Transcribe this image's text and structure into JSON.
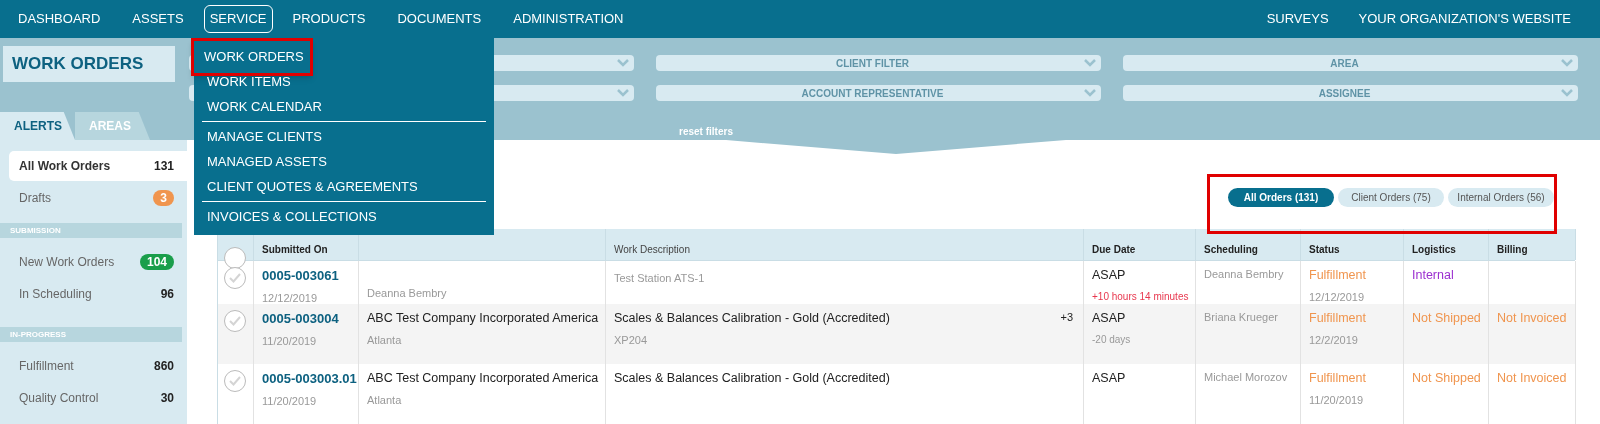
{
  "nav": {
    "items": [
      {
        "label": "DASHBOARD",
        "selected": false
      },
      {
        "label": "ASSETS",
        "selected": false
      },
      {
        "label": "SERVICE",
        "selected": true
      },
      {
        "label": "PRODUCTS",
        "selected": false
      },
      {
        "label": "DOCUMENTS",
        "selected": false
      },
      {
        "label": "ADMINISTRATION",
        "selected": false
      }
    ],
    "right_items": [
      "SURVEYS",
      "YOUR ORGANIZATION'S WEBSITE"
    ]
  },
  "service_menu": {
    "groups": [
      {
        "items": [
          {
            "label": "WORK ORDERS",
            "highlighted": true
          },
          {
            "label": "WORK ITEMS",
            "highlighted": false
          },
          {
            "label": "WORK CALENDAR",
            "highlighted": false
          }
        ]
      },
      {
        "items": [
          {
            "label": "MANAGE CLIENTS",
            "highlighted": false
          },
          {
            "label": "MANAGED ASSETS",
            "highlighted": false
          },
          {
            "label": "CLIENT QUOTES & AGREEMENTS",
            "highlighted": false
          }
        ]
      },
      {
        "items": [
          {
            "label": "INVOICES & COLLECTIONS",
            "highlighted": false
          }
        ]
      }
    ]
  },
  "page_title": "WORK ORDERS",
  "filters": {
    "rows": [
      [
        {},
        {
          "placeholder": "CLIENT FILTER"
        },
        {
          "placeholder": "AREA"
        }
      ],
      [
        {},
        {
          "placeholder": "ACCOUNT REPRESENTATIVE"
        },
        {
          "placeholder": "ASSIGNEE"
        }
      ]
    ],
    "reset": "reset filters"
  },
  "sidebar": {
    "tabs": [
      {
        "label": "ALERTS",
        "selected": true
      },
      {
        "label": "AREAS",
        "selected": false
      }
    ],
    "sections": [
      {
        "items": [
          {
            "label": "All Work Orders",
            "count": "131",
            "selected": true
          },
          {
            "label": "Drafts",
            "count": "3",
            "selected": false,
            "color": "#f0954e"
          }
        ]
      },
      {
        "title": "SUBMISSION",
        "items": [
          {
            "label": "New Work Orders",
            "count": "104",
            "selected": false,
            "color": "#1a9e4b"
          },
          {
            "label": "In Scheduling",
            "count": "96",
            "selected": false
          }
        ]
      },
      {
        "title": "IN-PROGRESS",
        "items": [
          {
            "label": "Fulfillment",
            "count": "860",
            "selected": false
          },
          {
            "label": "Quality Control",
            "count": "30",
            "selected": false
          }
        ]
      }
    ]
  },
  "order_filter": {
    "highlighted": true,
    "pills": [
      {
        "label": "All Orders (131)",
        "selected": true
      },
      {
        "label": "Client Orders (75)",
        "selected": false
      },
      {
        "label": "Internal Orders (56)",
        "selected": false
      }
    ]
  },
  "table": {
    "all_checked": false,
    "columns": [
      "Submitted On",
      "Work Description",
      "Due Date",
      "Scheduling",
      "Status",
      "Logistics",
      "Billing"
    ],
    "rows": [
      {
        "checked": false,
        "order": "0005-003061",
        "date": "12/12/2019",
        "client_sub": "Deanna Bembry",
        "description_sub": "Test Station ATS-1",
        "due": "ASAP",
        "due_note": {
          "text": "+10 hours 14 minutes",
          "color": "#e8384f"
        },
        "scheduling": "Deanna Bembry",
        "status": "Fulfillment",
        "status_date": "12/12/2019",
        "logistics": {
          "text": "Internal",
          "color": "#9b2fd0"
        }
      },
      {
        "checked": false,
        "order": "0005-003004",
        "date": "11/20/2019",
        "client": "ABC Test Company Incorporated America",
        "client_sub": "Atlanta",
        "description": "Scales & Balances Calibration - Gold (Accredited)",
        "description_sub": "XP204",
        "extra": "+3",
        "due": "ASAP",
        "due_note": {
          "text": "-20 days",
          "color": "#999999"
        },
        "scheduling": "Briana Krueger",
        "status": "Fulfillment",
        "status_date": "12/2/2019",
        "logistics": {
          "text": "Not Shipped",
          "color": "#f0954e"
        },
        "billing": "Not Invoiced"
      },
      {
        "checked": false,
        "order": "0005-003003.01",
        "date": "11/20/2019",
        "client": "ABC Test Company Incorporated America",
        "client_sub": "Atlanta",
        "description": "Scales & Balances Calibration - Gold (Accredited)",
        "due": "ASAP",
        "scheduling": "Michael Morozov",
        "status": "Fulfillment",
        "status_date": "11/20/2019",
        "logistics": {
          "text": "Not Shipped",
          "color": "#f0954e"
        },
        "billing": "Not Invoiced"
      }
    ]
  }
}
